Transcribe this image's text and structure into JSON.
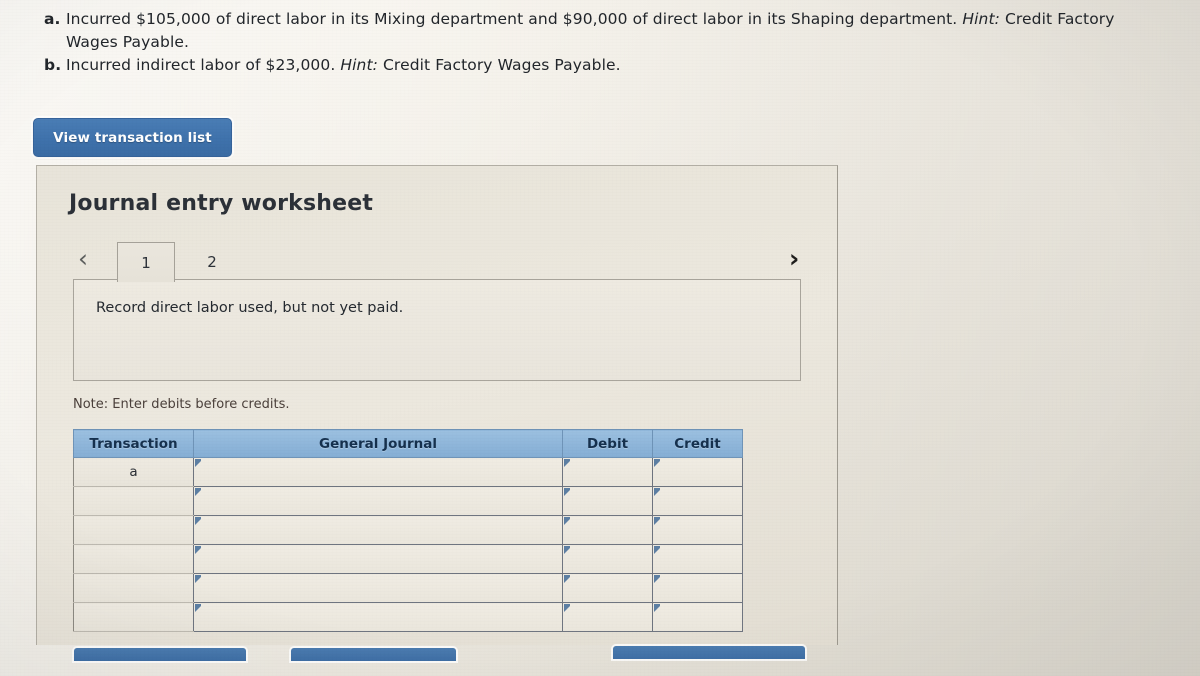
{
  "question": {
    "items": [
      {
        "letter": "a.",
        "text_before_hint": "Incurred $105,000 of direct labor in its Mixing department and $90,000 of direct labor in its Shaping department. ",
        "hint_label": "Hint:",
        "text_after_hint": " Credit Factory Wages Payable."
      },
      {
        "letter": "b.",
        "text_before_hint": "Incurred indirect labor of $23,000. ",
        "hint_label": "Hint:",
        "text_after_hint": " Credit Factory Wages Payable."
      }
    ]
  },
  "toolbar": {
    "view_transaction_list_label": "View transaction list"
  },
  "worksheet": {
    "title": "Journal entry worksheet",
    "nav": {
      "prev_icon": "chevron-left-icon",
      "prev_glyph": "‹",
      "next_icon": "chevron-right-icon",
      "next_glyph": "›"
    },
    "tabs": [
      {
        "label": "1",
        "active": true
      },
      {
        "label": "2",
        "active": false
      }
    ],
    "instruction": "Record direct labor used, but not yet paid.",
    "note": "Note: Enter debits before credits.",
    "table": {
      "headers": [
        "Transaction",
        "General Journal",
        "Debit",
        "Credit"
      ],
      "rows": [
        {
          "transaction": "a",
          "general_journal": "",
          "debit": "",
          "credit": ""
        },
        {
          "transaction": "",
          "general_journal": "",
          "debit": "",
          "credit": ""
        },
        {
          "transaction": "",
          "general_journal": "",
          "debit": "",
          "credit": ""
        },
        {
          "transaction": "",
          "general_journal": "",
          "debit": "",
          "credit": ""
        },
        {
          "transaction": "",
          "general_journal": "",
          "debit": "",
          "credit": ""
        },
        {
          "transaction": "",
          "general_journal": "",
          "debit": "",
          "credit": ""
        }
      ]
    }
  },
  "footer_bars": [
    {
      "name": "record-entry-bar"
    },
    {
      "name": "clear-entry-bar"
    },
    {
      "name": "view-general-journal-bar"
    }
  ],
  "colors": {
    "button_blue": "#3f72ac",
    "table_header_blue": "#8fb6da",
    "table_header_text": "#16314e",
    "page_background": "#efebe2",
    "panel_background": "#e7e3d8"
  }
}
